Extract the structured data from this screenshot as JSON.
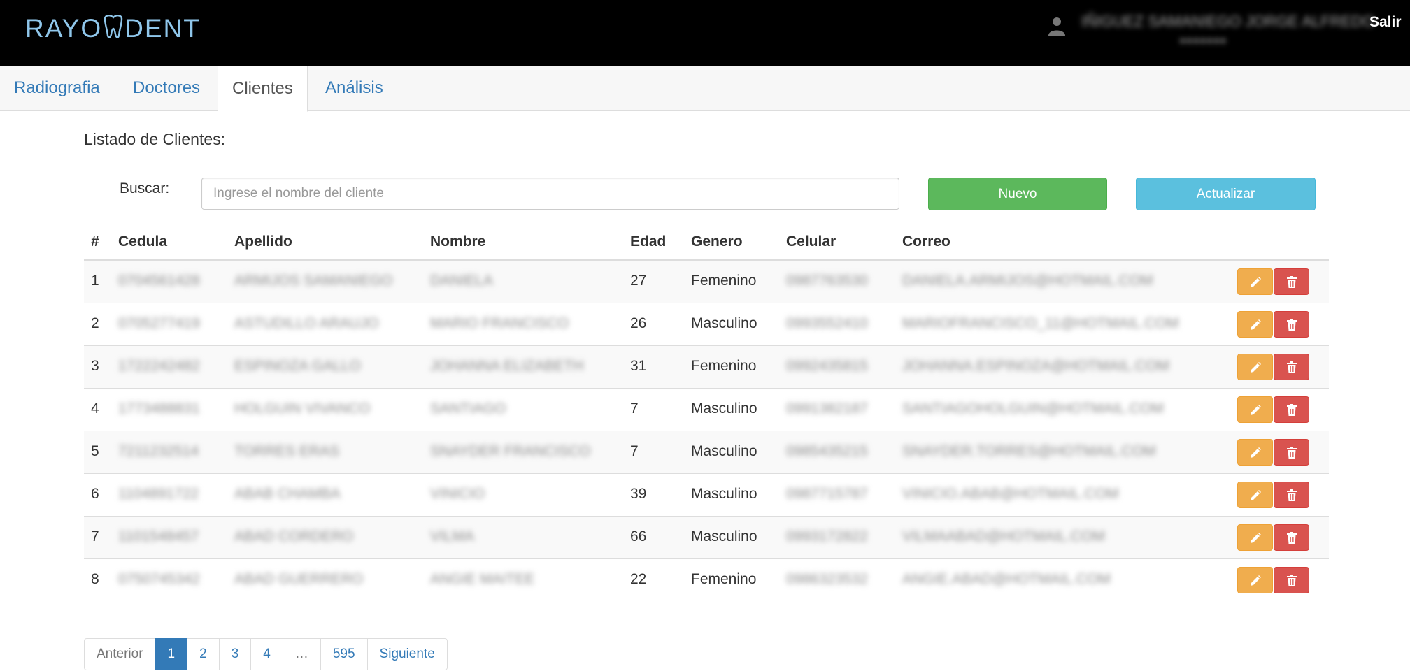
{
  "app": {
    "brand": "RAYODENT",
    "brand_prefix": "RAYO",
    "brand_suffix": "DENT",
    "user_name": "IÑIGUEZ SAMANIEGO JORGE ALFREDO",
    "user_sub": "●●●●●●●",
    "logout": "Salir",
    "colors": {
      "header": "#000000",
      "brand": "#8fc6ea",
      "link": "#337ab7",
      "success": "#5cb85c",
      "info": "#5bc0de",
      "warning": "#f0ad4e",
      "danger": "#d9534f"
    }
  },
  "tabs": [
    {
      "label": "Radiografia",
      "active": false
    },
    {
      "label": "Doctores",
      "active": false
    },
    {
      "label": "Clientes",
      "active": true
    },
    {
      "label": "Análisis",
      "active": false
    }
  ],
  "main": {
    "title": "Listado de Clientes:",
    "search_label": "Buscar:",
    "search_placeholder": "Ingrese el nombre del cliente",
    "btn_new": "Nuevo",
    "btn_refresh": "Actualizar"
  },
  "table": {
    "columns": [
      "#",
      "Cedula",
      "Apellido",
      "Nombre",
      "Edad",
      "Genero",
      "Celular",
      "Correo"
    ],
    "rows": [
      [
        "1",
        "0704561428",
        "ARMIJOS SAMANIEGO",
        "DANIELA",
        "27",
        "Femenino",
        "0987763530",
        "DANIELA.ARMIJOS@HOTMAIL.COM"
      ],
      [
        "2",
        "0705277419",
        "ASTUDILLO ARAUJO",
        "MARIO FRANCISCO",
        "26",
        "Masculino",
        "0993552410",
        "MARIOFRANCISCO_11@HOTMAIL.COM"
      ],
      [
        "3",
        "1722242482",
        "ESPINOZA GALLO",
        "JOHANNA ELIZABETH",
        "31",
        "Femenino",
        "0992435815",
        "JOHANNA.ESPINOZA@HOTMAIL.COM"
      ],
      [
        "4",
        "1773488831",
        "HOLGUIN VIVANCO",
        "SANTIAGO",
        "7",
        "Masculino",
        "0991382187",
        "SANTIAGOHOLGUIN@HOTMAIL.COM"
      ],
      [
        "5",
        "7211232514",
        "TORRES ERAS",
        "SNAYDER FRANCISCO",
        "7",
        "Masculino",
        "0985435215",
        "SNAYDER.TORRES@HOTMAIL.COM"
      ],
      [
        "6",
        "1104891722",
        "ABAB CHAMBA",
        "VINICIO",
        "39",
        "Masculino",
        "0987715787",
        "VINICIO.ABAB@HOTMAIL.COM"
      ],
      [
        "7",
        "1101548457",
        "ABAD CORDERO",
        "VILMA",
        "66",
        "Masculino",
        "0993172822",
        "VILMAABAD@HOTMAIL.COM"
      ],
      [
        "8",
        "0750745342",
        "ABAD GUERRERO",
        "ANGIE MAITEE",
        "22",
        "Femenino",
        "0986323532",
        "ANGIE.ABAD@HOTMAIL.COM"
      ]
    ]
  },
  "pagination": {
    "prev": "Anterior",
    "pages": [
      "1",
      "2",
      "3",
      "4",
      "…",
      "595"
    ],
    "active": "1",
    "next": "Siguiente"
  }
}
